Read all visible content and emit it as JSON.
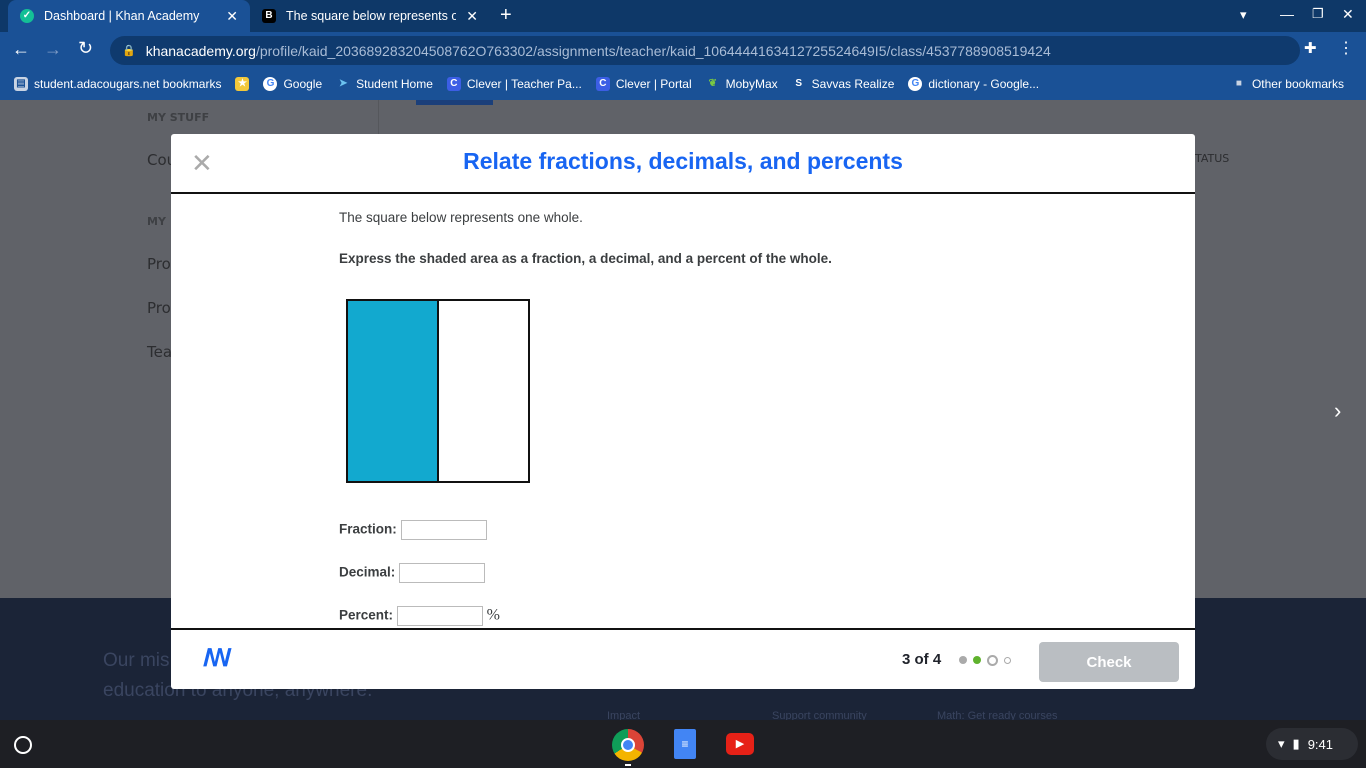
{
  "browser": {
    "tabs": [
      {
        "title": "Dashboard | Khan Academy",
        "active": true
      },
      {
        "title": "The square below represents one",
        "active": false
      }
    ],
    "url_host": "khanacademy.org",
    "url_path": "/profile/kaid_203689283204508762O763302/assignments/teacher/kaid_1064444163412725524649I5/class/4537788908519424",
    "bookmarks": [
      "student.adacougars.net bookmarks",
      "Google",
      "Student Home",
      "Clever | Teacher Pa...",
      "Clever | Portal",
      "MobyMax",
      "Savvas Realize",
      "dictionary - Google..."
    ],
    "other_bookmarks": "Other bookmarks"
  },
  "background": {
    "section1": "MY STUFF",
    "item1": "Cou",
    "section2": "MY",
    "items": [
      "Pro",
      "Pro",
      "Tea"
    ],
    "status_col": "TATUS",
    "mission": [
      "Our mis",
      "education to anyone, anywhere."
    ],
    "links": [
      "Impact",
      "Support community",
      "Math: Get ready courses"
    ]
  },
  "modal": {
    "title": "Relate fractions, decimals, and percents",
    "intro": "The square below represents one whole.",
    "instruction": "Express the shaded area as a fraction, a decimal, and a percent of the whole.",
    "figure": {
      "parts": 2,
      "shaded": 1,
      "shade_color": "#12a9cf"
    },
    "fraction_label": "Fraction:",
    "decimal_label": "Decimal:",
    "percent_label": "Percent:",
    "percent_sign": "%",
    "progress": "3 of 4",
    "check_label": "Check"
  },
  "shelf": {
    "time": "9:41"
  }
}
